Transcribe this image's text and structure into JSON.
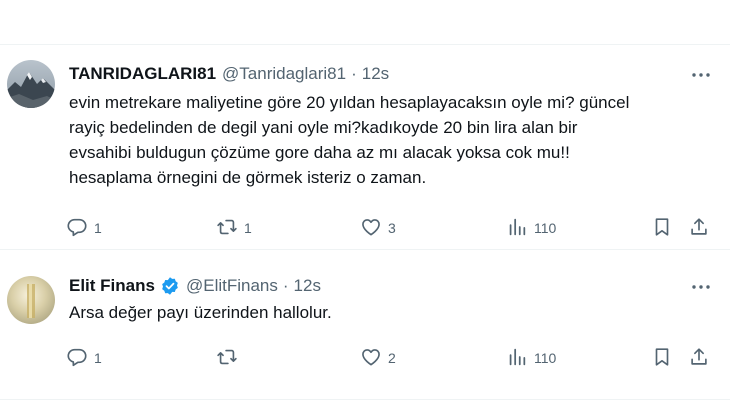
{
  "tweets": [
    {
      "display_name": "TANRIDAGLARI81",
      "handle": "@Tanridaglari81",
      "separator": "·",
      "time": "12s",
      "verified": false,
      "text_lines": [
        "evin metrekare maliyetine göre 20 yıldan hesaplayacaksın oyle mi? güncel",
        "rayiç bedelinden de degil yani oyle mi?kadıkoyde 20 bin lira alan bir",
        "evsahibi buldugun çözüme gore daha az mı alacak yoksa cok mu!!",
        "hesaplama örnegini de görmek isteriz o zaman."
      ],
      "stats": {
        "replies": "1",
        "retweets": "1",
        "likes": "3",
        "views": "110"
      }
    },
    {
      "display_name": "Elit Finans",
      "handle": "@ElitFinans",
      "separator": "·",
      "time": "12s",
      "verified": true,
      "text_lines": [
        "Arsa değer payı üzerinden hallolur."
      ],
      "stats": {
        "replies": "1",
        "retweets": "",
        "likes": "2",
        "views": "110"
      }
    }
  ],
  "colors": {
    "text_primary": "#0f1419",
    "text_secondary": "#536471",
    "divider": "#eff3f4",
    "verified_badge": "#1d9bf0"
  },
  "icons": [
    "reply-icon",
    "retweet-icon",
    "like-icon",
    "views-icon",
    "bookmark-icon",
    "share-icon",
    "more-icon",
    "verified-badge-icon"
  ]
}
